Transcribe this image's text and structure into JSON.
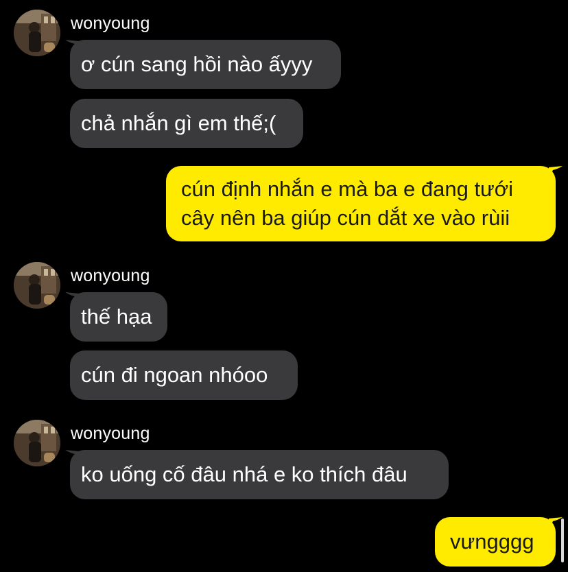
{
  "colors": {
    "background": "#000000",
    "incoming_bubble": "#3a3a3c",
    "outgoing_bubble": "#ffeb00",
    "incoming_text": "#ffffff",
    "outgoing_text": "#1a1a1a"
  },
  "conversation": [
    {
      "sender": "wonyoung",
      "messages": [
        "ơ cún sang hồi nào ấyyy",
        "chả nhắn gì em thế;("
      ]
    },
    {
      "sender": "me",
      "messages": [
        "cún định nhắn e mà ba e đang tưới cây nên ba giúp cún dắt xe vào rùii"
      ]
    },
    {
      "sender": "wonyoung",
      "messages": [
        "thế hạa",
        "cún đi ngoan nhóoo"
      ]
    },
    {
      "sender": "wonyoung",
      "messages": [
        "ko uống cố đâu nhá e ko thích đâu"
      ]
    },
    {
      "sender": "me",
      "messages": [
        "vưngggg"
      ]
    }
  ]
}
